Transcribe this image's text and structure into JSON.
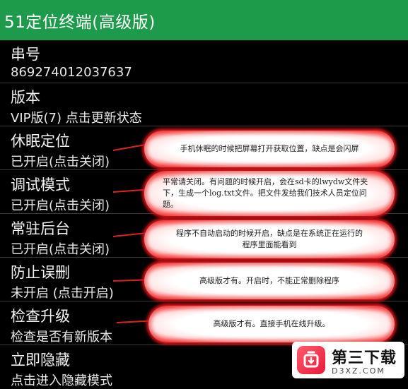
{
  "app": {
    "title": "51定位终端(高级版)"
  },
  "settings": [
    {
      "label": "串号",
      "value": "869274012037637"
    },
    {
      "label": "版本",
      "value": "VIP版(7) 点击更新状态"
    },
    {
      "label": "休眠定位",
      "value": "已开启(点击关闭)"
    },
    {
      "label": "调试模式",
      "value": "已开启(点击关闭)"
    },
    {
      "label": "常驻后台",
      "value": "已开启(点击关闭)"
    },
    {
      "label": "防止误删",
      "value": "未开启 (点击开启)"
    },
    {
      "label": "检查升级",
      "value": "检查是否有新版本"
    },
    {
      "label": "立即隐藏",
      "value": "点击进入隐藏模式"
    }
  ],
  "notes": [
    {
      "text": "手机休眠的时候把屏幕打开获取位置，缺点是会闪屏"
    },
    {
      "line1": "平常请关闭。有问题的时候开启，会在sd卡的lwydw文件夹",
      "line2": "下，生成一个log.txt文件。把文件发给我们技术人员定位问",
      "line3": "题。"
    },
    {
      "line1": "程序不自动启动的时候开启，缺点是在系统正在运行的",
      "line2": "程序里面能看到"
    },
    {
      "text": "高级版才有。开启时，不能正常删除程序"
    },
    {
      "text": "高级版才有。直接手机在线升级。"
    }
  ],
  "watermark": {
    "name": "第三下载",
    "domain": "D3XZ.COM"
  },
  "colors": {
    "titlebar": "#1d9a4a",
    "background": "#000000",
    "callout_border": "#e31b1b"
  }
}
